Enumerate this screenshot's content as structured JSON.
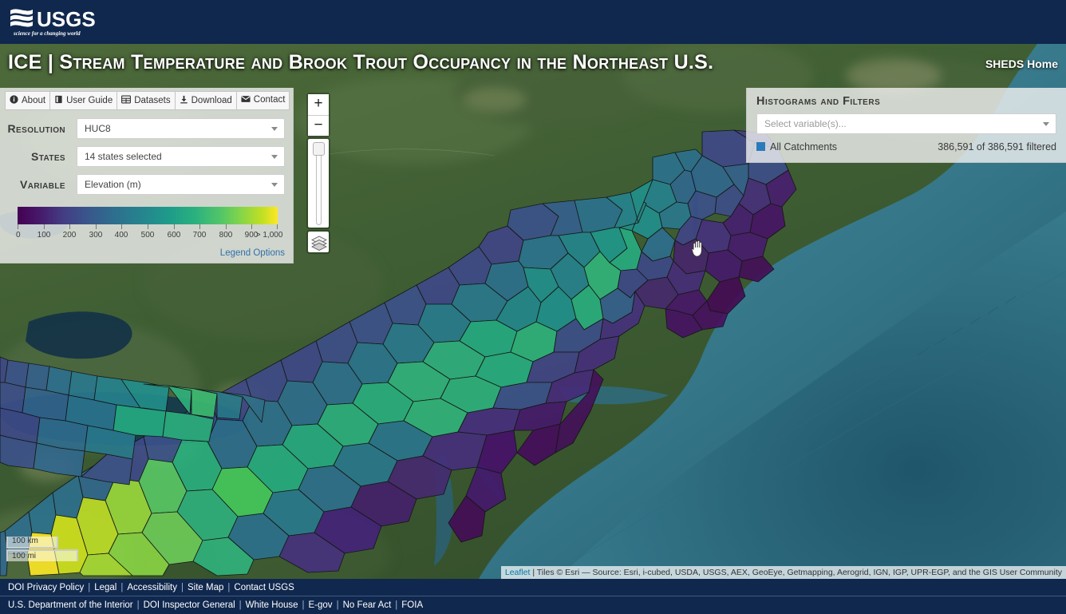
{
  "header": {
    "logo_alt": "USGS science for a changing world",
    "logo_text": "USGS",
    "logo_tagline": "science for a changing world",
    "bg_color": "#10284e"
  },
  "title_band": {
    "title": "ICE | Stream Temperature and Brook Trout Occupancy in the Northeast U.S.",
    "home_link": "SHEDS Home"
  },
  "nav_buttons": [
    {
      "label": "About",
      "icon": "info-circle-icon"
    },
    {
      "label": "User Guide",
      "icon": "book-icon"
    },
    {
      "label": "Datasets",
      "icon": "table-icon"
    },
    {
      "label": "Download",
      "icon": "download-icon"
    },
    {
      "label": "Contact",
      "icon": "envelope-icon"
    }
  ],
  "controls": {
    "resolution": {
      "label": "Resolution",
      "value": "HUC8"
    },
    "states": {
      "label": "States",
      "value": "14 states selected"
    },
    "variable": {
      "label": "Variable",
      "value": "Elevation (m)"
    }
  },
  "legend": {
    "colormap": "viridis",
    "ticks": [
      "0",
      "100",
      "200",
      "300",
      "400",
      "500",
      "600",
      "700",
      "800",
      "900",
      "> 1,000"
    ],
    "options_link": "Legend Options",
    "start_color": "#440154",
    "end_color": "#fde725"
  },
  "filters_panel": {
    "title": "Histograms and Filters",
    "select_placeholder": "Select variable(s)...",
    "series_label": "All Catchments",
    "series_color": "#2b7bba",
    "count_text": "386,591 of 386,591 filtered"
  },
  "map": {
    "zoom_in_label": "+",
    "zoom_out_label": "−",
    "scale_km": "100 km",
    "scale_mi": "100 mi",
    "attribution_leaflet": "Leaflet",
    "attribution_text": "| Tiles © Esri — Source: Esri, i-cubed, USDA, USGS, AEX, GeoEye, Getmapping, Aerogrid, IGN, IGP, UPR-EGP, and the GIS User Community"
  },
  "footer": {
    "row1": [
      "DOI Privacy Policy",
      "Legal",
      "Accessibility",
      "Site Map",
      "Contact USGS"
    ],
    "row2": [
      "U.S. Department of the Interior",
      "DOI Inspector General",
      "White House",
      "E-gov",
      "No Fear Act",
      "FOIA"
    ]
  }
}
